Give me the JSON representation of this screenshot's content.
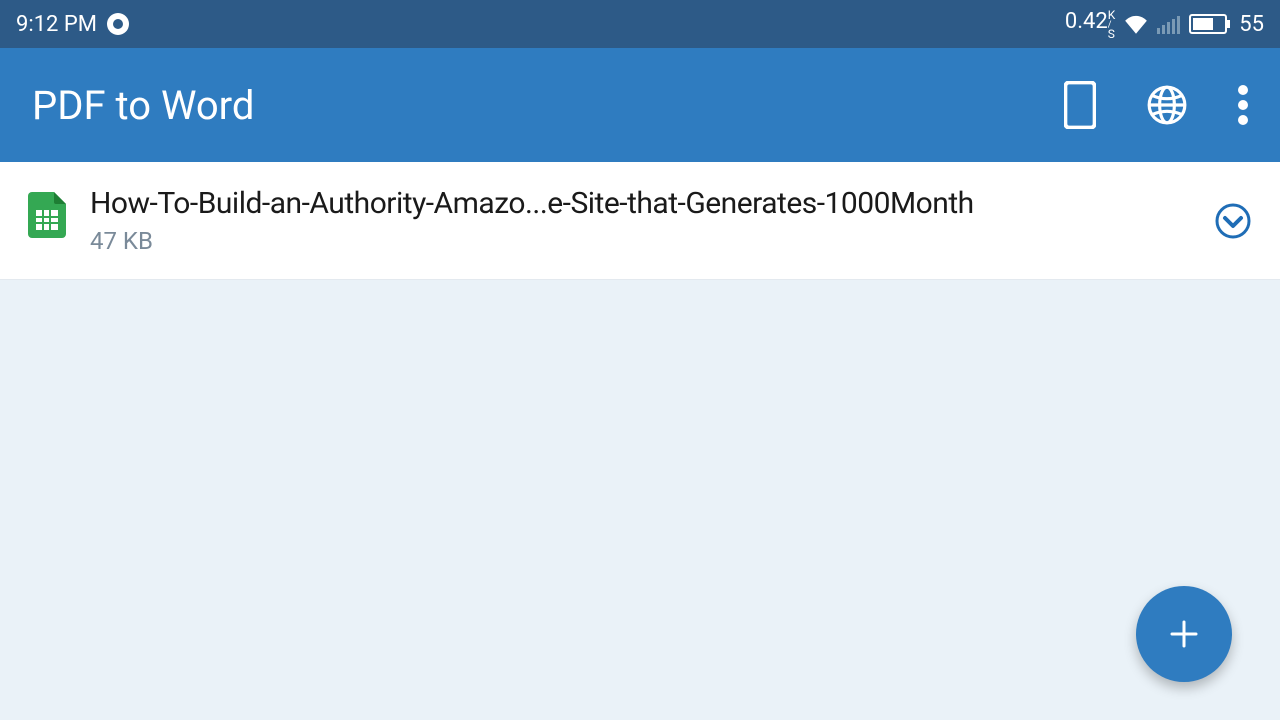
{
  "status": {
    "time": "9:12 PM",
    "speed_value": "0.42",
    "speed_unit_top": "K",
    "speed_unit_bottom": "S",
    "battery": "55"
  },
  "appbar": {
    "title": "PDF to Word"
  },
  "files": [
    {
      "name": "How-To-Build-an-Authority-Amazo...e-Site-that-Generates-1000Month",
      "size": "47 KB"
    }
  ],
  "fab": {
    "label": "+"
  }
}
